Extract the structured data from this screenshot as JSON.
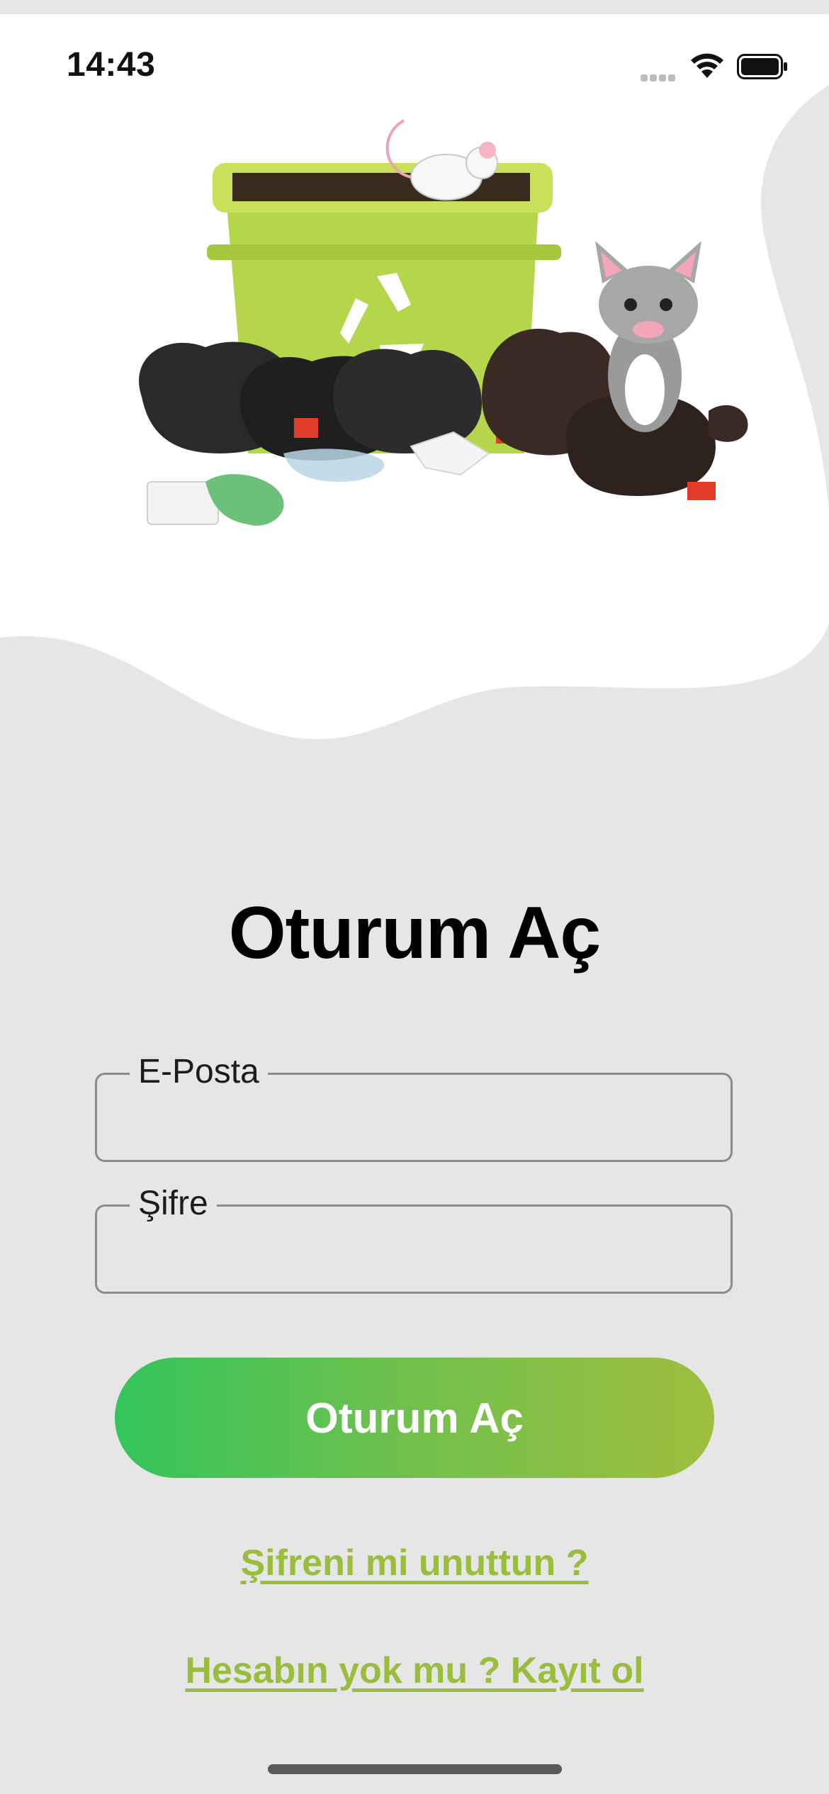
{
  "status_bar": {
    "time": "14:43"
  },
  "login": {
    "title": "Oturum Aç",
    "email": {
      "label": "E-Posta",
      "value": ""
    },
    "password": {
      "label": "Şifre",
      "value": ""
    },
    "submit_label": "Oturum Aç",
    "forgot_password_link": "Şifreni mi unuttun ?",
    "register_link": "Hesabın yok mu ? Kayıt ol"
  },
  "colors": {
    "background": "#e6e6e6",
    "hero_background": "#ffffff",
    "button_gradient_start": "#33c55b",
    "button_gradient_end": "#9fbe3d",
    "link": "#99bd3d",
    "bin_green": "#b8d94a"
  },
  "illustration": {
    "icon": "trash-bin-cat-mouse-illustration"
  }
}
